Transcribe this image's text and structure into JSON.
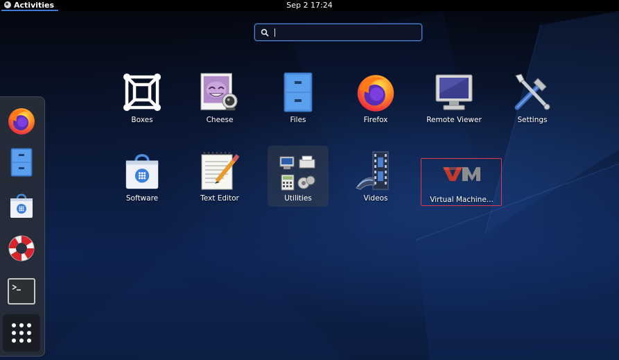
{
  "topbar": {
    "activities_label": "Activities",
    "clock": "Sep 2  17:24"
  },
  "search": {
    "value": "",
    "placeholder": ""
  },
  "dash": {
    "items": [
      {
        "name": "firefox",
        "icon": "firefox-icon"
      },
      {
        "name": "files",
        "icon": "file-cabinet-icon"
      },
      {
        "name": "software",
        "icon": "software-bag-icon"
      },
      {
        "name": "help",
        "icon": "lifebuoy-icon"
      },
      {
        "name": "terminal",
        "icon": "terminal-icon"
      },
      {
        "name": "show-applications",
        "icon": "app-grid-icon"
      }
    ]
  },
  "apps": [
    {
      "label": "Boxes",
      "icon": "boxes-icon"
    },
    {
      "label": "Cheese",
      "icon": "cheese-icon"
    },
    {
      "label": "Files",
      "icon": "file-cabinet-icon"
    },
    {
      "label": "Firefox",
      "icon": "firefox-icon"
    },
    {
      "label": "Remote Viewer",
      "icon": "monitor-icon"
    },
    {
      "label": "Settings",
      "icon": "tools-icon"
    },
    {
      "label": "Software",
      "icon": "software-bag-icon"
    },
    {
      "label": "Text Editor",
      "icon": "text-editor-icon"
    },
    {
      "label": "Utilities",
      "icon": "folder-icon"
    },
    {
      "label": "Videos",
      "icon": "film-icon"
    },
    {
      "label": "Virtual Machine...",
      "icon": "vmm-icon"
    }
  ],
  "colors": {
    "accent": "#3d7bd6",
    "selection": "#e0384e"
  }
}
